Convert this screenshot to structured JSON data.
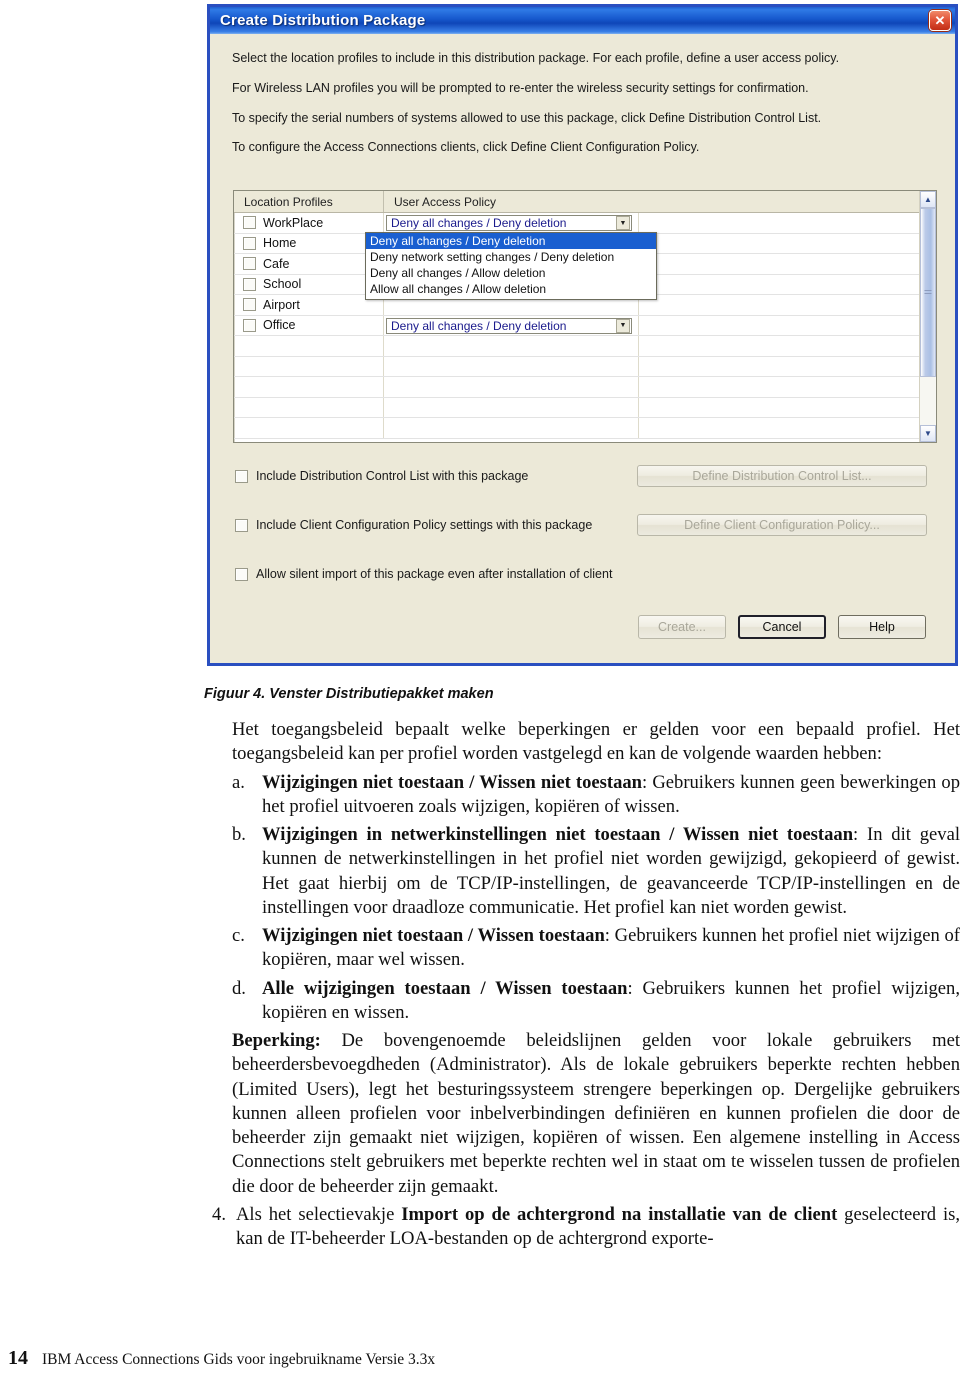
{
  "dialog": {
    "title": "Create Distribution Package",
    "close_icon": "close-icon",
    "instructions": [
      "Select the location profiles to include in this distribution package. For each profile, define a user access policy.",
      "For Wireless LAN profiles you will be prompted to re-enter the wireless security settings for confirmation.",
      "To specify the serial numbers of systems allowed to use this package, click Define Distribution Control List.",
      "To configure the Access Connections clients, click Define Client Configuration Policy."
    ],
    "table": {
      "columns": [
        "Location Profiles",
        "User Access Policy"
      ],
      "rows": [
        {
          "profile": "WorkPlace",
          "policy": "Deny all changes / Deny deletion",
          "checked": false,
          "combo": true
        },
        {
          "profile": "Home",
          "policy": "",
          "checked": false,
          "combo": false
        },
        {
          "profile": "Cafe",
          "policy": "",
          "checked": false,
          "combo": false
        },
        {
          "profile": "School",
          "policy": "",
          "checked": false,
          "combo": false
        },
        {
          "profile": "Airport",
          "policy": "",
          "checked": false,
          "combo": false
        },
        {
          "profile": "Office",
          "policy": "Deny all changes / Deny deletion",
          "checked": false,
          "combo": true
        },
        {
          "profile": "",
          "policy": "",
          "checked": null,
          "combo": false
        },
        {
          "profile": "",
          "policy": "",
          "checked": null,
          "combo": false
        },
        {
          "profile": "",
          "policy": "",
          "checked": null,
          "combo": false
        },
        {
          "profile": "",
          "policy": "",
          "checked": null,
          "combo": false
        },
        {
          "profile": "",
          "policy": "",
          "checked": null,
          "combo": false
        }
      ]
    },
    "dropdown": {
      "open": true,
      "selected_index": 0,
      "options": [
        "Deny all changes / Deny deletion",
        "Deny network setting changes / Deny deletion",
        "Deny all changes / Allow deletion",
        "Allow all changes / Allow deletion"
      ]
    },
    "scrollbar": {
      "up_icon": "chevron-up-icon",
      "down_icon": "chevron-down-icon"
    },
    "options": [
      {
        "label": "Include Distribution Control List with this package",
        "checked": false
      },
      {
        "label": "Include Client Configuration Policy settings with this package",
        "checked": false
      },
      {
        "label": "Allow silent import of this package even after installation of client",
        "checked": false
      }
    ],
    "side_buttons": [
      {
        "label": "Define Distribution Control List...",
        "enabled": false
      },
      {
        "label": "Define Client Configuration Policy...",
        "enabled": false
      }
    ],
    "action_buttons": [
      {
        "label": "Create...",
        "enabled": false,
        "default": false
      },
      {
        "label": "Cancel",
        "enabled": true,
        "default": true
      },
      {
        "label": "Help",
        "enabled": true,
        "default": false
      }
    ]
  },
  "document": {
    "figure_caption": "Figuur 4. Venster Distributiepakket maken",
    "intro": "Het toegangsbeleid bepaalt welke beperkingen er gelden voor een bepaald profiel. Het toegangsbeleid kan per profiel worden vastgelegd en kan de volgende waarden hebben:",
    "items": [
      {
        "marker": "a.",
        "bold": "Wijzigingen niet toestaan / Wissen niet toestaan",
        "rest": ": Gebruikers kunnen geen bewerkingen op het profiel uitvoeren zoals wijzigen, kopiëren of wissen."
      },
      {
        "marker": "b.",
        "bold": "Wijzigingen in netwerkinstellingen niet toestaan / Wissen niet toestaan",
        "rest": ": In dit geval kunnen de netwerkinstellingen in het profiel niet worden gewijzigd, gekopieerd of gewist. Het gaat hierbij om de TCP/IP-instellingen, de geavanceerde TCP/IP-instellingen en de instellingen voor draadloze communicatie. Het profiel kan niet worden gewist."
      },
      {
        "marker": "c.",
        "bold": "Wijzigingen niet toestaan / Wissen toestaan",
        "rest": ": Gebruikers kunnen het profiel niet wijzigen of kopiëren, maar wel wissen."
      },
      {
        "marker": "d.",
        "bold": "Alle wijzigingen toestaan / Wissen toestaan",
        "rest": ": Gebruikers kunnen het profiel wijzigen, kopiëren en wissen."
      }
    ],
    "note_bold": "Beperking:",
    "note_rest": " De bovengenoemde beleidslijnen gelden voor lokale gebruikers met beheerdersbevoegdheden (Administrator). Als de lokale gebruikers beperkte rechten hebben (Limited Users), legt het besturingssysteem strengere beperkingen op. Dergelijke gebruikers kunnen alleen profielen voor inbelverbindingen definiëren en kunnen profielen die door de beheerder zijn gemaakt niet wijzigen, kopiëren of wissen. Een algemene instelling in Access Connections stelt gebruikers met beperkte rechten wel in staat om te wisselen tussen de profielen die door de beheerder zijn gemaakt.",
    "step": {
      "marker": "4.",
      "pre": "Als het selectievakje ",
      "bold": "Import op de achtergrond na installatie van de client",
      "rest": " geselecteerd is, kan de IT-beheerder LOA-bestanden op de achtergrond exporte-"
    }
  },
  "footer": {
    "page_number": "14",
    "text": "IBM Access Connections Gids voor ingebruikname Versie 3.3x"
  }
}
